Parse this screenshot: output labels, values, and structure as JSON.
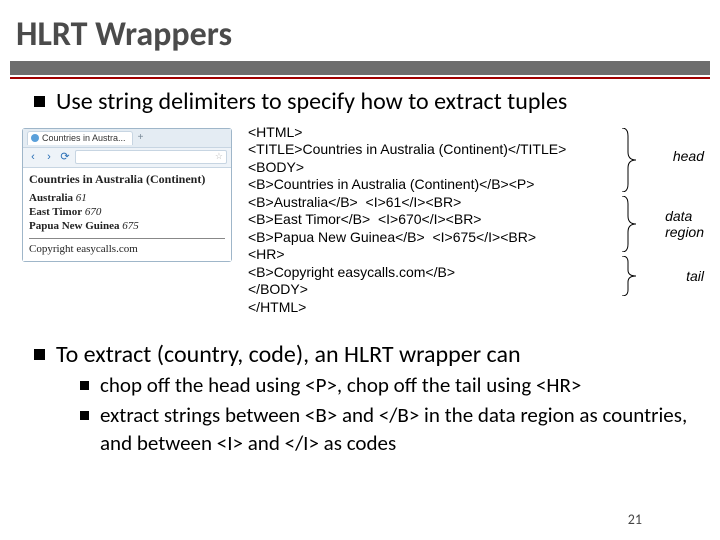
{
  "title": "HLRT Wrappers",
  "bullets": {
    "b1": "Use string delimiters to specify how to extract tuples",
    "b2": "To extract (country, code), an HLRT wrapper can",
    "b2_sub1": "chop off the head using <P>, chop off the tail using <HR>",
    "b2_sub2": "extract strings between <B> and </B> in the data region as countries, and between <I> and </I> as codes"
  },
  "browser": {
    "tab_title": "Countries in Austra...",
    "plus": "+",
    "nav_back": "‹",
    "nav_fwd": "›",
    "reload": "⟳",
    "star": "☆",
    "page_title": "Countries in Australia (Continent)",
    "rows": [
      {
        "country": "Australia",
        "code": "61"
      },
      {
        "country": "East Timor",
        "code": "670"
      },
      {
        "country": "Papua New Guinea",
        "code": "675"
      }
    ],
    "copyright": "Copyright easycalls.com"
  },
  "source_lines": {
    "l0": "<HTML>",
    "l1": "<TITLE>Countries in Australia (Continent)</TITLE>",
    "l2": "<BODY>",
    "l3": "<B>Countries in Australia (Continent)</B><P>",
    "l4": "<B>Australia</B>  <I>61</I><BR>",
    "l5": "<B>East Timor</B>  <I>670</I><BR>",
    "l6": "<B>Papua New Guinea</B>  <I>675</I><BR>",
    "l7": "<HR>",
    "l8": "<B>Copyright easycalls.com</B>",
    "l9": "</BODY>",
    "l10": "</HTML>"
  },
  "labels": {
    "head": "head",
    "data": "data\nregion",
    "tail": "tail"
  },
  "page_number": "21"
}
